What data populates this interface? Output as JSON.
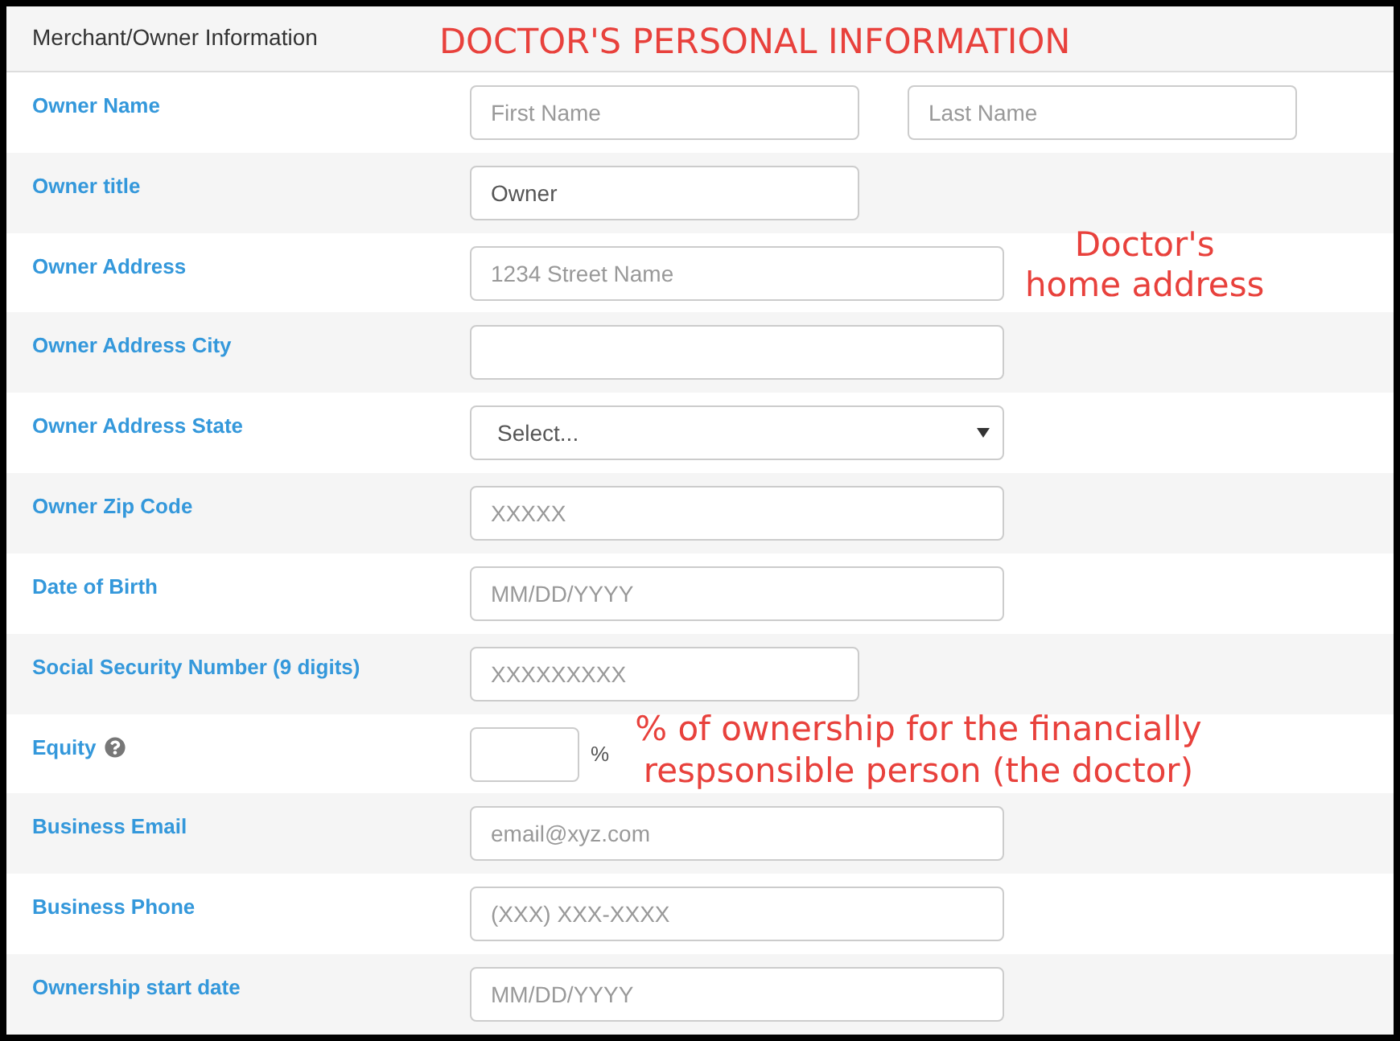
{
  "section": {
    "title": "Merchant/Owner Information",
    "note": "DOCTOR'S PERSONAL INFORMATION"
  },
  "fields": [
    {
      "label": "Owner Name",
      "kind": "pair",
      "inputs": [
        {
          "placeholder": "First Name"
        },
        {
          "placeholder": "Last Name"
        }
      ]
    },
    {
      "label": "Owner title",
      "kind": "short",
      "value": "Owner"
    },
    {
      "label": "Owner Address",
      "kind": "text",
      "placeholder": "1234 Street Name",
      "note": "Doctor's\nhome address"
    },
    {
      "label": "Owner Address City",
      "kind": "text"
    },
    {
      "label": "Owner Address State",
      "kind": "select",
      "value": "Select..."
    },
    {
      "label": "Owner Zip Code",
      "kind": "text",
      "placeholder": "XXXXX"
    },
    {
      "label": "Date of Birth",
      "kind": "text",
      "placeholder": "MM/DD/YYYY"
    },
    {
      "label": "Social Security Number (9 digits)",
      "kind": "short",
      "placeholder": "XXXXXXXXX"
    },
    {
      "label": "Equity",
      "kind": "percent",
      "help": true,
      "suffix": "%",
      "note": "% of ownership for the financially\nrespsonsible person (the doctor)"
    },
    {
      "label": "Business Email",
      "kind": "text",
      "placeholder": "email@xyz.com"
    },
    {
      "label": "Business Phone",
      "kind": "text",
      "placeholder": "(XXX) XXX-XXXX"
    },
    {
      "label": "Ownership start date",
      "kind": "text",
      "placeholder": "MM/DD/YYYY"
    }
  ]
}
